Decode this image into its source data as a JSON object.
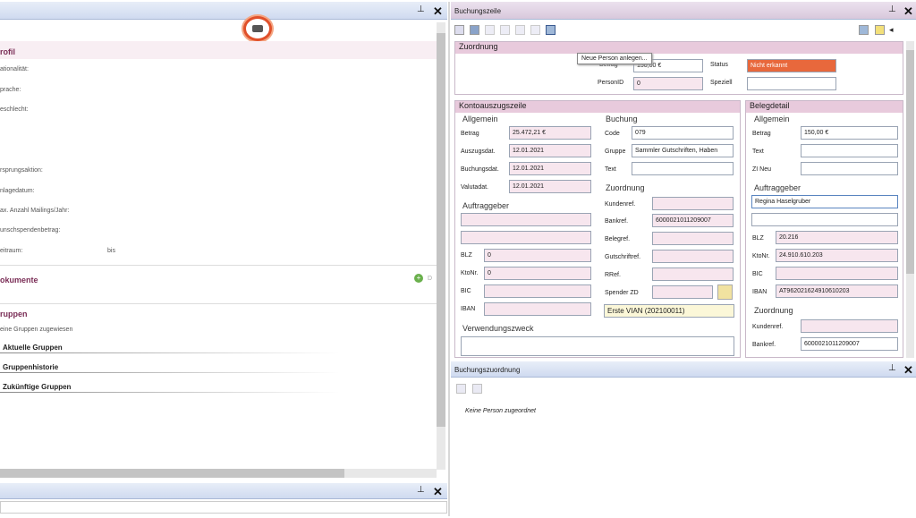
{
  "left": {
    "fields": [
      "ationalität:",
      "prache:",
      "eschlecht:",
      "rsprungsaktion:",
      "nlagedatum:",
      "ax. Anzahl Mailings/Jahr:",
      "unschspendenbetrag:",
      "eitraum:"
    ],
    "bis": "bis",
    "profil": "rofil",
    "dokumente": "okumente",
    "dokumente_right": "D",
    "gruppen": "ruppen",
    "keine_gruppen": "eine Gruppen zugewiesen",
    "aktuelle": "Aktuelle Gruppen",
    "historie": "Gruppenhistorie",
    "zukunft": "Zukünftige Gruppen"
  },
  "buchungszeile": {
    "title": "Buchungszeile",
    "tooltip": "Neue Person anlegen...",
    "zuordnung": {
      "title": "Zuordnung",
      "betrag_label": "Betrag",
      "betrag_value": "150,00 €",
      "status_label": "Status",
      "status_value": "Nicht erkannt",
      "personid_label": "PersonID",
      "personid_value": "0",
      "speziell_label": "Speziell",
      "speziell_value": ""
    },
    "konto": {
      "title": "Kontoauszugszeile",
      "allgemein": "Allgemein",
      "betrag": "Betrag",
      "betrag_v": "25.472,21 €",
      "auszug": "Auszugsdat.",
      "auszug_v": "12.01.2021",
      "buchungsdat": "Buchungsdat.",
      "buchungsdat_v": "12.01.2021",
      "valuta": "Valutadat.",
      "valuta_v": "12.01.2021",
      "auftraggeber": "Auftraggeber",
      "blz": "BLZ",
      "blz_v": "0",
      "ktonr": "KtoNr.",
      "ktonr_v": "0",
      "bic": "BIC",
      "iban": "IBAN",
      "verwendung": "Verwendungszweck",
      "buchung": "Buchung",
      "code": "Code",
      "code_v": "079",
      "gruppe": "Gruppe",
      "gruppe_v": "Sammler Gutschriften, Haben",
      "text": "Text",
      "zuordnung": "Zuordnung",
      "kundenref": "Kundenref.",
      "bankref": "Bankref.",
      "bankref_v": "6000021011209007",
      "belegref": "Belegref.",
      "gutschrift": "Gutschriftref.",
      "rref": "RRef.",
      "spender": "Spender ZD",
      "erste": "Erste VIAN (202100011)"
    },
    "beleg": {
      "title": "Belegdetail",
      "allgemein": "Allgemein",
      "betrag": "Betrag",
      "betrag_v": "150,00 €",
      "text": "Text",
      "zineu": "ZI Neu",
      "auftraggeber": "Auftraggeber",
      "name_v": "Regina Haselgruber",
      "blz": "BLZ",
      "blz_v": "20.216",
      "ktonr": "KtoNr.",
      "ktonr_v": "24.910.610.203",
      "bic": "BIC",
      "iban": "IBAN",
      "iban_v": "AT962021624910610203",
      "zuordnung": "Zuordnung",
      "kundenref": "Kundenref.",
      "bankref": "Bankref.",
      "bankref_v": "6000021011209007"
    }
  },
  "buchungszuordnung": {
    "title": "Buchungszuordnung",
    "keine": "Keine Person zugeordnet"
  },
  "icons": {
    "pin": "pin-icon",
    "close": "close-icon"
  }
}
